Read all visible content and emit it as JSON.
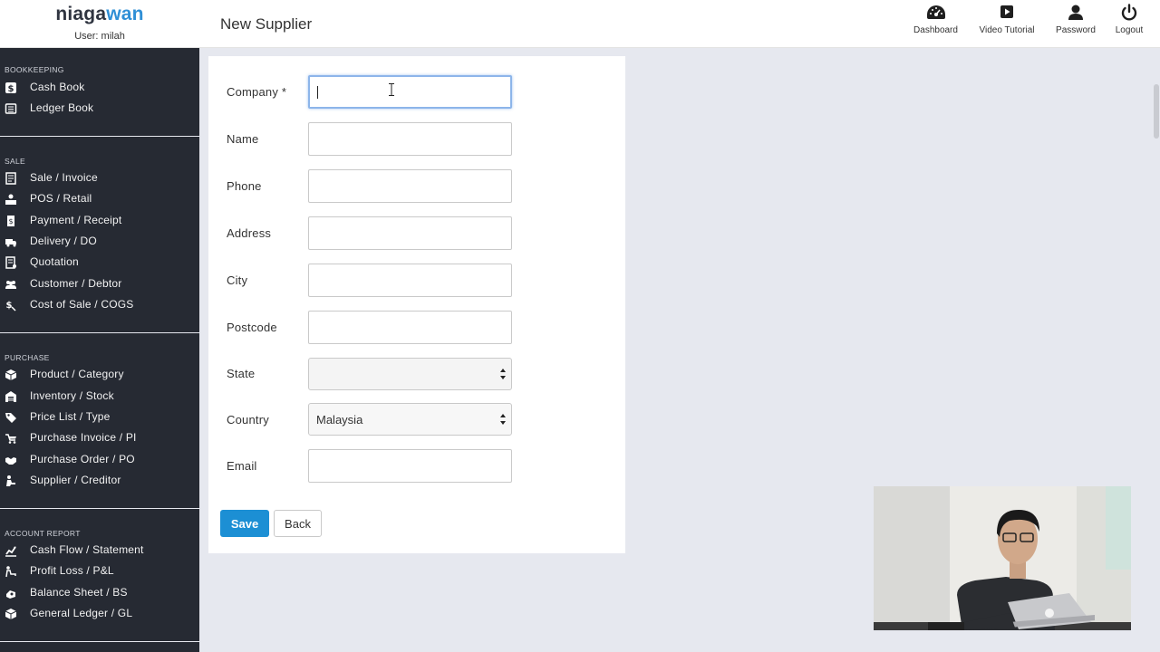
{
  "brand": {
    "name_part1": "niaga",
    "name_part2": "wan",
    "user_line": "User: milah"
  },
  "page": {
    "title": "New Supplier"
  },
  "top_actions": [
    {
      "label": "Dashboard",
      "icon": "dashboard-icon"
    },
    {
      "label": "Video Tutorial",
      "icon": "video-icon"
    },
    {
      "label": "Password",
      "icon": "user-icon"
    },
    {
      "label": "Logout",
      "icon": "power-icon"
    }
  ],
  "sidebar": {
    "sections": [
      {
        "heading": "BOOKKEEPING",
        "items": [
          {
            "label": "Cash Book",
            "icon": "dollar-icon"
          },
          {
            "label": "Ledger Book",
            "icon": "ledger-icon"
          }
        ]
      },
      {
        "heading": "SALE",
        "items": [
          {
            "label": "Sale / Invoice",
            "icon": "invoice-icon"
          },
          {
            "label": "POS / Retail",
            "icon": "cashier-icon"
          },
          {
            "label": "Payment / Receipt",
            "icon": "receipt-icon"
          },
          {
            "label": "Delivery / DO",
            "icon": "truck-icon"
          },
          {
            "label": "Quotation",
            "icon": "quotation-icon"
          },
          {
            "label": "Customer / Debtor",
            "icon": "users-icon"
          },
          {
            "label": "Cost of Sale / COGS",
            "icon": "cost-icon"
          }
        ]
      },
      {
        "heading": "PURCHASE",
        "items": [
          {
            "label": "Product / Category",
            "icon": "box-icon"
          },
          {
            "label": "Inventory / Stock",
            "icon": "warehouse-icon"
          },
          {
            "label": "Price List / Type",
            "icon": "tag-icon"
          },
          {
            "label": "Purchase Invoice / PI",
            "icon": "purchase-invoice-icon"
          },
          {
            "label": "Purchase Order / PO",
            "icon": "handshake-icon"
          },
          {
            "label": "Supplier / Creditor",
            "icon": "supplier-icon"
          }
        ]
      },
      {
        "heading": "ACCOUNT REPORT",
        "items": [
          {
            "label": "Cash Flow / Statement",
            "icon": "cashflow-icon"
          },
          {
            "label": "Profit Loss / P&L",
            "icon": "profit-icon"
          },
          {
            "label": "Balance Sheet / BS",
            "icon": "balance-icon"
          },
          {
            "label": "General Ledger / GL",
            "icon": "ledger-box-icon"
          }
        ]
      }
    ]
  },
  "form": {
    "company": {
      "label": "Company *",
      "value": ""
    },
    "name": {
      "label": "Name",
      "value": ""
    },
    "phone": {
      "label": "Phone",
      "value": ""
    },
    "address": {
      "label": "Address",
      "value": ""
    },
    "city": {
      "label": "City",
      "value": ""
    },
    "postcode": {
      "label": "Postcode",
      "value": ""
    },
    "state": {
      "label": "State",
      "value": ""
    },
    "country": {
      "label": "Country",
      "value": "Malaysia"
    },
    "email": {
      "label": "Email",
      "value": ""
    },
    "save_label": "Save",
    "back_label": "Back"
  },
  "colors": {
    "accent": "#1c8fd4",
    "sidebar_bg": "#262a33",
    "page_bg": "#e6e8ef",
    "brand_blue": "#2f8fd6"
  }
}
